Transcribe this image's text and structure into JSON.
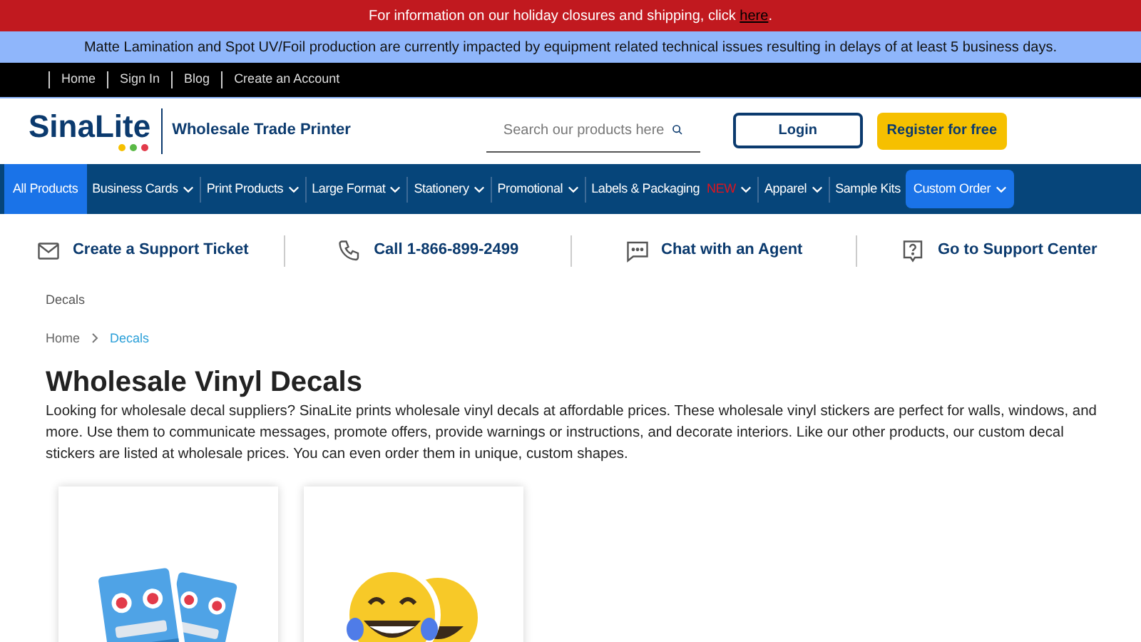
{
  "holiday_banner": {
    "text": "For information on our holiday closures and shipping, click ",
    "link": "here",
    "end": "."
  },
  "notice_banner": {
    "text": "Matte Lamination and Spot UV/Foil production are currently impacted by equipment related technical issues resulting in delays of at least 5 business days."
  },
  "top_links": [
    "Home",
    "Sign In",
    "Blog",
    "Create an Account"
  ],
  "header": {
    "logo": "SinaLite",
    "tagline": "Wholesale Trade Printer",
    "search": {
      "placeholder": "Search our products here"
    },
    "login": "Login",
    "register": "Register for free"
  },
  "nav": [
    {
      "label": "All Products",
      "selected": true,
      "dropdown": false,
      "kind": "link"
    },
    {
      "label": "Business Cards",
      "selected": false,
      "dropdown": true,
      "kind": "link"
    },
    {
      "label": "Print Products",
      "selected": false,
      "dropdown": true,
      "kind": "link"
    },
    {
      "label": "Large Format",
      "selected": false,
      "dropdown": true,
      "kind": "link"
    },
    {
      "label": "Stationery",
      "selected": false,
      "dropdown": true,
      "kind": "link"
    },
    {
      "label": "Promotional",
      "selected": false,
      "dropdown": true,
      "kind": "link"
    },
    {
      "label": "Labels & Packaging",
      "badge": "NEW",
      "selected": false,
      "dropdown": true,
      "kind": "link"
    },
    {
      "label": "Apparel",
      "selected": false,
      "dropdown": true,
      "kind": "link"
    },
    {
      "label": "Sample Kits",
      "selected": false,
      "dropdown": false,
      "kind": "link"
    },
    {
      "label": "Custom Order",
      "selected": false,
      "dropdown": true,
      "kind": "button"
    }
  ],
  "support": [
    {
      "label": "Create a Support Ticket",
      "kind": "mail"
    },
    {
      "label": "Call 1-866-899-2499",
      "kind": "phone"
    },
    {
      "label": "Chat with an Agent",
      "kind": "chat"
    },
    {
      "label": "Go to Support Center",
      "kind": "help"
    }
  ],
  "page_label": "Decals",
  "breadcrumb": [
    {
      "label": "Home",
      "selected": false
    },
    {
      "label": "Decals",
      "selected": true
    }
  ],
  "title": "Wholesale Vinyl Decals",
  "description": "Looking for wholesale decal suppliers? SinaLite prints wholesale vinyl decals at affordable prices. These wholesale vinyl stickers are perfect for walls, windows, and more. Use them to communicate messages, promote offers, provide warnings or instructions, and decorate interiors. Like our other products, our custom decal stickers are listed at wholesale prices. You can even order them in unique, custom shapes.",
  "products": [
    {
      "kind": "robot"
    },
    {
      "kind": "emoji"
    }
  ]
}
